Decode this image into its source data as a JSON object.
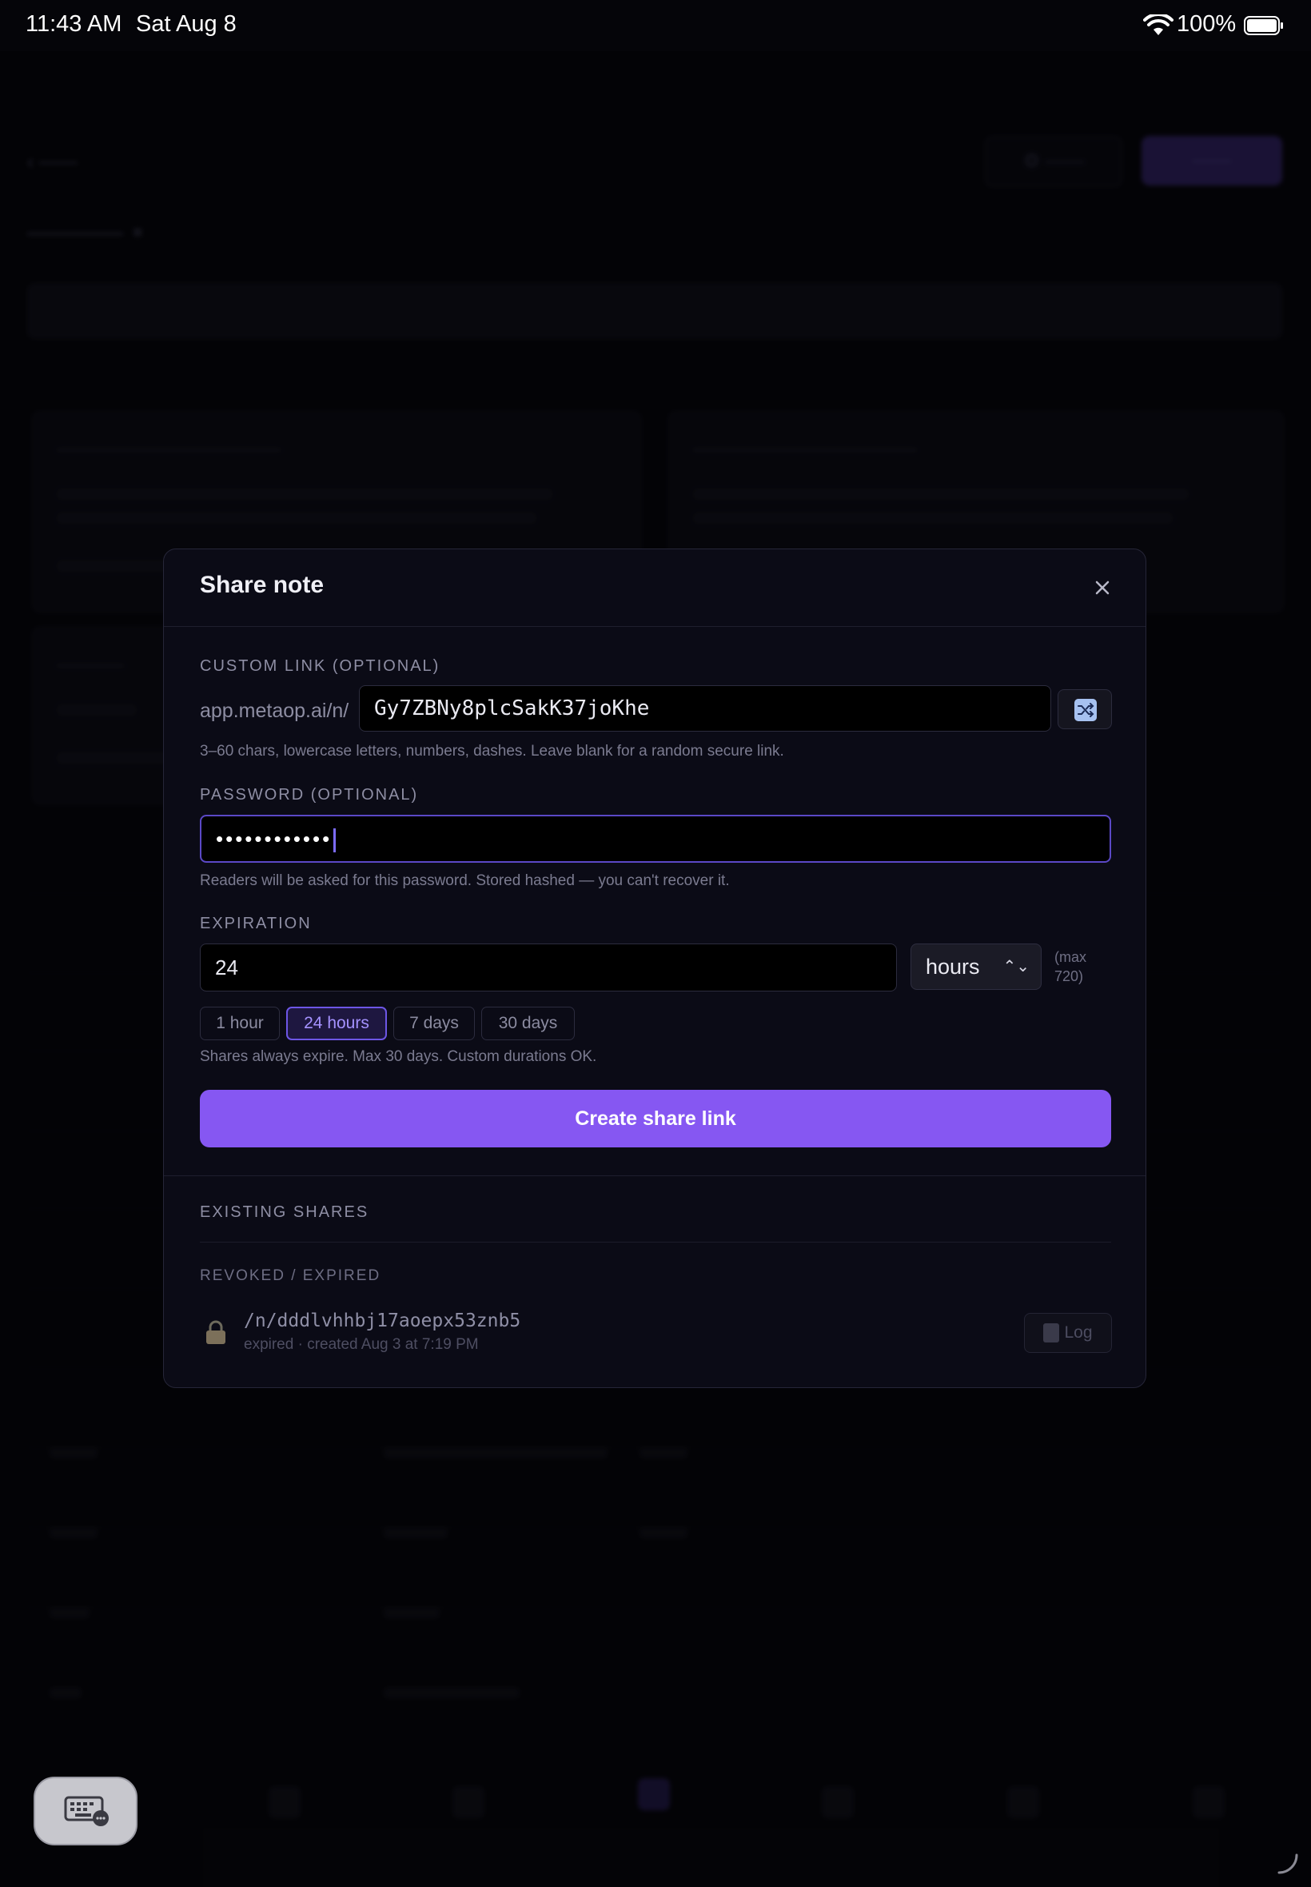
{
  "status_bar": {
    "time": "11:43 AM",
    "date": "Sat Aug 8",
    "battery": "100%"
  },
  "modal": {
    "title": "Share note",
    "close_icon": "close-icon",
    "custom_link": {
      "label": "CUSTOM LINK (OPTIONAL)",
      "prefix": "app.metaop.ai/n/",
      "value": "Gy7ZBNy8plcSakK37joKhe",
      "shuffle_icon": "shuffle-icon",
      "help": "3–60 chars, lowercase letters, numbers, dashes. Leave blank for a random secure link."
    },
    "password": {
      "label": "PASSWORD (OPTIONAL)",
      "masked_value": "••••••••••••",
      "help": "Readers will be asked for this password. Stored hashed — you can't recover it."
    },
    "expiration": {
      "label": "EXPIRATION",
      "value": "24",
      "unit": "hours",
      "max_note": "(max 720)",
      "presets": [
        "1 hour",
        "24 hours",
        "7 days",
        "30 days"
      ],
      "active_preset": "24 hours",
      "help": "Shares always expire. Max 30 days. Custom durations OK."
    },
    "create_button": "Create share link",
    "existing_shares": {
      "label": "EXISTING SHARES",
      "revoked_label": "REVOKED / EXPIRED",
      "items": [
        {
          "path": "/n/dddlvhhbj17aoepx53znb5",
          "meta": "expired · created Aug 3 at 7:19 PM",
          "log_button": "Log",
          "icon": "lock-icon"
        }
      ]
    }
  },
  "colors": {
    "accent": "#8657f2",
    "background": "#0b0b16",
    "active_chip_text": "#a592ff"
  }
}
